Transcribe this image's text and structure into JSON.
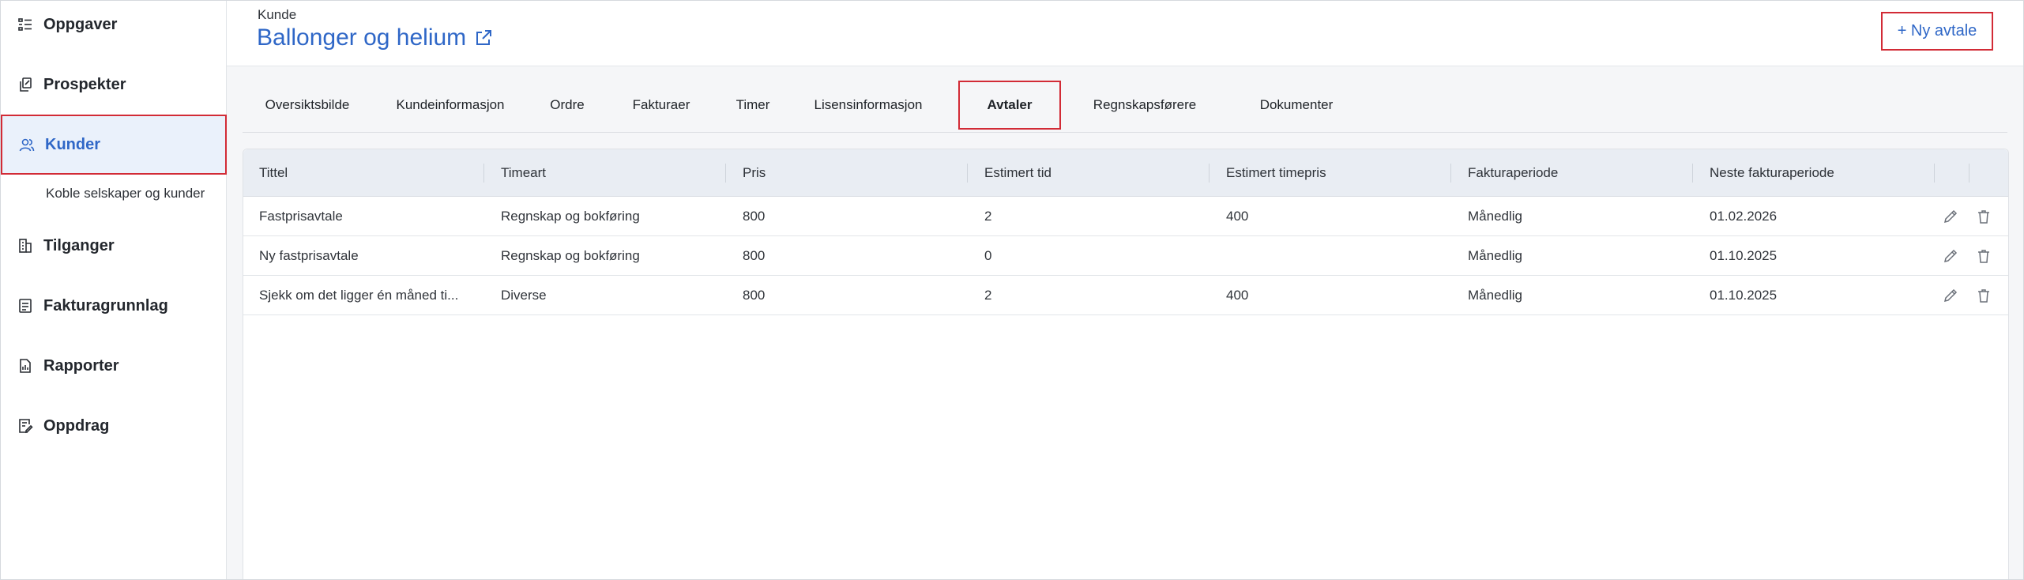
{
  "sidebar": {
    "items": [
      {
        "label": "Oppgaver",
        "icon": "task-list-icon"
      },
      {
        "label": "Prospekter",
        "icon": "prospect-icon"
      },
      {
        "label": "Kunder",
        "icon": "users-icon"
      },
      {
        "label": "Tilganger",
        "icon": "building-icon"
      },
      {
        "label": "Fakturagrunnlag",
        "icon": "document-icon"
      },
      {
        "label": "Rapporter",
        "icon": "report-icon"
      },
      {
        "label": "Oppdrag",
        "icon": "edit-document-icon"
      }
    ],
    "active": "Kunder",
    "sub_item": "Koble selskaper og kunder"
  },
  "header": {
    "label": "Kunde",
    "title": "Ballonger og helium",
    "new_button": "+ Ny avtale"
  },
  "tabs": [
    "Oversiktsbilde",
    "Kundeinformasjon",
    "Ordre",
    "Fakturaer",
    "Timer",
    "Lisensinformasjon",
    "Avtaler",
    "Regnskapsførere",
    "Dokumenter"
  ],
  "active_tab": "Avtaler",
  "table": {
    "columns": [
      "Tittel",
      "Timeart",
      "Pris",
      "Estimert tid",
      "Estimert timepris",
      "Fakturaperiode",
      "Neste fakturaperiode"
    ],
    "rows": [
      [
        "Fastprisavtale",
        "Regnskap og bokføring",
        "800",
        "2",
        "400",
        "Månedlig",
        "01.02.2026"
      ],
      [
        "Ny fastprisavtale",
        "Regnskap og bokføring",
        "800",
        "0",
        "",
        "Månedlig",
        "01.10.2025"
      ],
      [
        "Sjekk om det ligger én måned ti...",
        "Diverse",
        "800",
        "2",
        "400",
        "Månedlig",
        "01.10.2025"
      ]
    ]
  },
  "colors": {
    "accent": "#2f67c7",
    "highlight_border": "#d22b36",
    "active_bg": "#eaf1fb",
    "table_header_bg": "#e9edf3"
  }
}
